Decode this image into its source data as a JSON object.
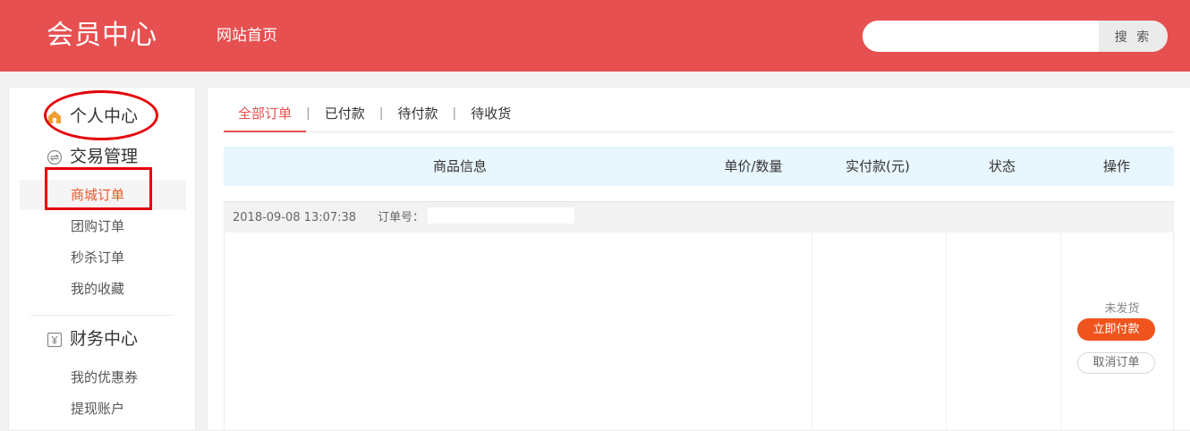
{
  "header": {
    "logo": "会员中心",
    "home_link": "网站首页",
    "search_placeholder": "",
    "search_button": "搜 索"
  },
  "sidebar": {
    "sections": [
      {
        "title": "个人中心",
        "icon": "home-icon"
      },
      {
        "title": "交易管理",
        "icon": "exchange-icon",
        "items": [
          "商城订单",
          "团购订单",
          "秒杀订单",
          "我的收藏"
        ],
        "active": "商城订单"
      },
      {
        "title": "财务中心",
        "icon": "yuan-icon",
        "items": [
          "我的优惠券",
          "提现账户"
        ]
      }
    ]
  },
  "tabs": [
    "全部订单",
    "已付款",
    "待付款",
    "待收货"
  ],
  "active_tab": "全部订单",
  "table": {
    "columns": [
      "商品信息",
      "单价/数量",
      "实付款(元)",
      "状态",
      "操作"
    ]
  },
  "order": {
    "time": "2018-09-08 13:07:38",
    "order_no_label": "订单号：",
    "status": "未发货",
    "pay_button": "立即付款",
    "cancel_button": "取消订单"
  },
  "colors": {
    "header_bg": "#e65050",
    "accent": "#e8562a",
    "pay_button": "#f0541e",
    "table_head_bg": "#e8f6fd",
    "annotation": "#e5000a"
  }
}
